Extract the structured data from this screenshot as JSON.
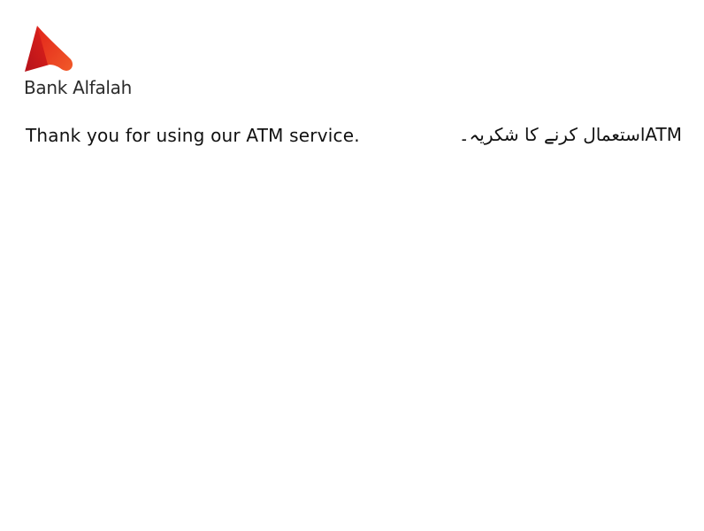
{
  "brand": {
    "name": "Bank Alfalah",
    "logo_icon": "bank-alfalah-logo-icon",
    "colors": {
      "logo_red_dark": "#b5121b",
      "logo_red": "#e2231a",
      "logo_orange": "#f15a29"
    }
  },
  "message": {
    "english": "Thank you for using our ATM service.",
    "urdu": "ATMاستعمال کرنے کا شکریہ۔"
  }
}
